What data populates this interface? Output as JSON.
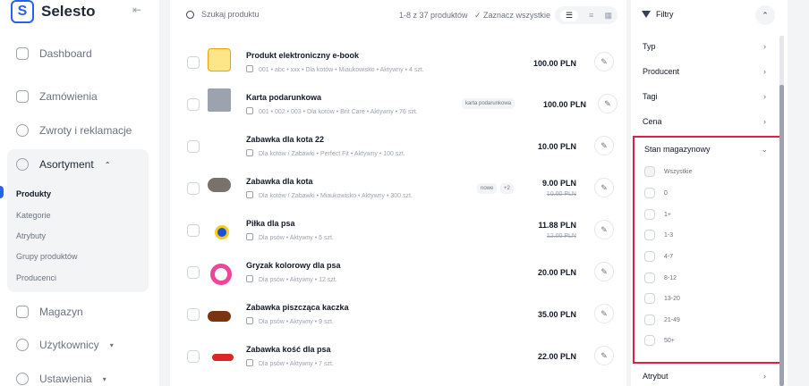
{
  "app": {
    "name": "Selesto"
  },
  "sidebar": {
    "items": [
      {
        "label": "Dashboard"
      },
      {
        "label": "Zamówienia"
      },
      {
        "label": "Zwroty i reklamacje"
      }
    ],
    "group": {
      "label": "Asortyment",
      "subitems": [
        "Produkty",
        "Kategorie",
        "Atrybuty",
        "Grupy produktów",
        "Producenci"
      ]
    },
    "bottom": [
      {
        "label": "Magazyn"
      },
      {
        "label": "Użytkownicy"
      },
      {
        "label": "Ustawienia"
      }
    ]
  },
  "toolbar": {
    "search_placeholder": "Szukaj produktu",
    "count": "1-8 z 37 produktów",
    "select_all": "Zaznacz wszystkie"
  },
  "products": [
    {
      "name": "Produkt elektroniczny e-book",
      "meta": "001  •  abc  •  xxx  •  Dla kotów  •  Miaukowisko  •  Aktywny  •  4 szt.",
      "price": "100.00 PLN",
      "old_price": "",
      "tags": []
    },
    {
      "name": "Karta podarunkowa",
      "meta": "001  •  002  •  003  •  Dla kotów  •  Brit Care  •  Aktywny  •  76 szt.",
      "price": "100.00 PLN",
      "old_price": "",
      "tags": [
        "karta podarunkowa"
      ]
    },
    {
      "name": "Zabawka dla kota 22",
      "meta": "Dla kotów / Zabawki  •  Perfect Fit  •  Aktywny  •  100 szt.",
      "price": "10.00 PLN",
      "old_price": "",
      "tags": []
    },
    {
      "name": "Zabawka dla kota",
      "meta": "Dla kotów / Zabawki  •  Miaukowisko  •  Aktywny  •  300 szt.",
      "price": "9.00 PLN",
      "old_price": "10.00 PLN",
      "tags": [
        "nowe",
        "+2"
      ]
    },
    {
      "name": "Piłka dla psa",
      "meta": "Dla psów  •  Aktywny  •  5 szt.",
      "price": "11.88 PLN",
      "old_price": "12.00 PLN",
      "tags": []
    },
    {
      "name": "Gryzak kolorowy dla psa",
      "meta": "Dla psów  •  Aktywny  •  12 szt.",
      "price": "20.00 PLN",
      "old_price": "",
      "tags": []
    },
    {
      "name": "Zabawka piszcząca kaczka",
      "meta": "Dla psów  •  Aktywny  •  9 szt.",
      "price": "35.00 PLN",
      "old_price": "",
      "tags": []
    },
    {
      "name": "Zabawka kość dla psa",
      "meta": "Dla psów  •  Aktywny  •  7 szt.",
      "price": "22.00 PLN",
      "old_price": "",
      "tags": []
    }
  ],
  "filters": {
    "title": "Filtry",
    "sections": [
      "Typ",
      "Producent",
      "Tagi",
      "Cena"
    ],
    "stock": {
      "label": "Stan magazynowy",
      "options": [
        "Wszystkie",
        "0",
        "1+",
        "1-3",
        "4-7",
        "8-12",
        "13-20",
        "21-49",
        "50+"
      ]
    },
    "after": [
      "Atrybut"
    ]
  }
}
